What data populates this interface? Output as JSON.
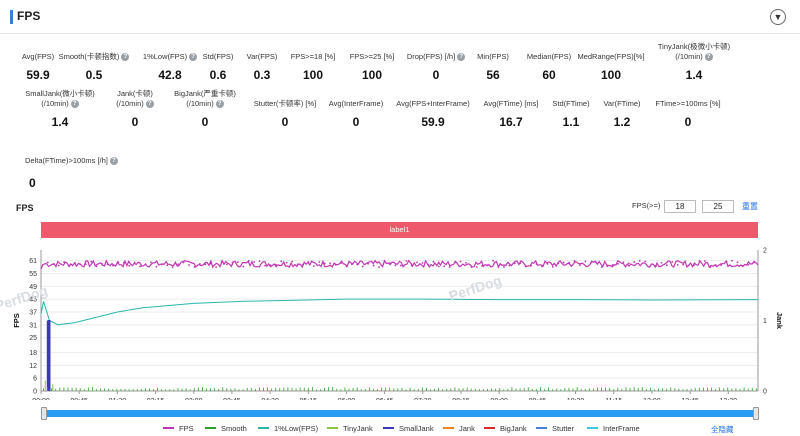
{
  "header": {
    "title": "FPS"
  },
  "metrics": [
    {
      "label": "Avg(FPS)",
      "value": "59.9",
      "q": false
    },
    {
      "label": "Smooth(卡顿指数)",
      "value": "0.5",
      "q": true
    },
    {
      "label": "1%Low(FPS)",
      "value": "42.8",
      "q": true
    },
    {
      "label": "Std(FPS)",
      "value": "0.6",
      "q": false
    },
    {
      "label": "Var(FPS)",
      "value": "0.3",
      "q": false
    },
    {
      "label": "FPS>=18 [%]",
      "value": "100",
      "q": false
    },
    {
      "label": "FPS>=25 [%]",
      "value": "100",
      "q": false
    },
    {
      "label": "Drop(FPS) [/h]",
      "value": "0",
      "q": true
    },
    {
      "label": "Min(FPS)",
      "value": "56",
      "q": false
    },
    {
      "label": "Median(FPS)",
      "value": "60",
      "q": false
    },
    {
      "label": "MedRange(FPS)[%]",
      "value": "100",
      "q": false
    },
    {
      "label": "TinyJank(极微小卡顿)",
      "label2": "(/10min)",
      "value": "1.4",
      "q": true
    },
    {
      "label": "SmallJank(微小卡顿)",
      "label2": "(/10min)",
      "value": "1.4",
      "q": true
    },
    {
      "label": "Jank(卡顿)",
      "label2": "(/10min)",
      "value": "0",
      "q": true
    },
    {
      "label": "BigJank(严重卡顿)",
      "label2": "(/10min)",
      "value": "0",
      "q": true
    },
    {
      "label": "Stutter(卡顿率) [%]",
      "value": "0",
      "q": false
    },
    {
      "label": "Avg(InterFrame)",
      "value": "0",
      "q": false
    },
    {
      "label": "Avg(FPS+InterFrame)",
      "value": "59.9",
      "q": false
    },
    {
      "label": "Avg(FTime) [ms]",
      "value": "16.7",
      "q": false
    },
    {
      "label": "Std(FTime)",
      "value": "1.1",
      "q": false
    },
    {
      "label": "Var(FTime)",
      "value": "1.2",
      "q": false
    },
    {
      "label": "FTime>=100ms [%]",
      "value": "0",
      "q": false
    },
    {
      "label": "Delta(FTime)>100ms [/h]",
      "value": "0",
      "q": true
    }
  ],
  "controls": {
    "chart_title": "FPS",
    "fps_threshold_label": "FPS(>=)",
    "threshold_1": "18",
    "threshold_2": "25",
    "reset_label": "重置",
    "label_band": "label1",
    "hide_all_label": "全隐藏"
  },
  "watermark": "PerfDog",
  "colors": {
    "fps": "#c233b5",
    "smooth": "#2aa12a",
    "low1": "#2ab7a9",
    "tinyjank": "#8cc63f",
    "smalljank": "#3a3ab8",
    "jank": "#f08020",
    "bigjank": "#e02a2a",
    "stutter": "#4a7fd8",
    "interframe": "#3cc8e0"
  },
  "chart_data": {
    "type": "line",
    "left_axis": {
      "label": "FPS",
      "ticks": [
        0,
        6,
        12,
        18,
        25,
        31,
        37,
        43,
        49,
        55,
        61
      ],
      "ylim": [
        0,
        66
      ]
    },
    "right_axis": {
      "label": "Jank",
      "ticks": [
        0,
        1,
        2
      ],
      "ylim": [
        0,
        2
      ]
    },
    "x_ticks": [
      "00:00",
      "00:45",
      "01:30",
      "02:15",
      "03:00",
      "03:45",
      "04:30",
      "05:15",
      "06:00",
      "06:45",
      "07:30",
      "08:15",
      "09:00",
      "09:45",
      "10:30",
      "11:15",
      "12:00",
      "12:45",
      "13:30"
    ],
    "x_tick_seconds": [
      0,
      45,
      90,
      135,
      180,
      225,
      270,
      315,
      360,
      405,
      450,
      495,
      540,
      585,
      630,
      675,
      720,
      765,
      810
    ],
    "xlim_seconds": [
      0,
      845
    ],
    "series": [
      {
        "name": "FPS",
        "axis": "left",
        "description_points": [
          [
            0,
            57
          ],
          [
            5,
            60
          ],
          [
            10,
            60
          ],
          [
            845,
            60
          ]
        ],
        "range": [
          58,
          61
        ]
      },
      {
        "name": "1%Low(FPS)",
        "axis": "left",
        "points": [
          [
            0,
            36
          ],
          [
            3,
            42
          ],
          [
            6,
            38
          ],
          [
            10,
            33
          ],
          [
            20,
            31
          ],
          [
            40,
            32
          ],
          [
            60,
            34
          ],
          [
            90,
            37
          ],
          [
            120,
            39
          ],
          [
            180,
            41
          ],
          [
            240,
            42
          ],
          [
            300,
            42.5
          ],
          [
            360,
            43
          ],
          [
            450,
            43
          ],
          [
            540,
            42.8
          ],
          [
            630,
            42.8
          ],
          [
            720,
            42.6
          ],
          [
            845,
            42.8
          ]
        ]
      },
      {
        "name": "SmallJank",
        "axis": "right",
        "bars": [
          [
            8,
            1
          ],
          [
            10,
            1
          ]
        ]
      },
      {
        "name": "TinyJank",
        "axis": "right",
        "note": "small spikes",
        "bars": [
          [
            5,
            0.15
          ],
          [
            14,
            0.1
          ]
        ]
      },
      {
        "name": "Smooth"
      },
      {
        "name": "Jank"
      },
      {
        "name": "BigJank"
      },
      {
        "name": "Stutter"
      },
      {
        "name": "InterFrame"
      }
    ]
  },
  "legend": [
    {
      "name": "FPS",
      "color": "#c233b5"
    },
    {
      "name": "Smooth",
      "color": "#2aa12a"
    },
    {
      "name": "1%Low(FPS)",
      "color": "#2ab7a9"
    },
    {
      "name": "TinyJank",
      "color": "#8cc63f"
    },
    {
      "name": "SmallJank",
      "color": "#3a3ab8"
    },
    {
      "name": "Jank",
      "color": "#f08020"
    },
    {
      "name": "BigJank",
      "color": "#e02a2a"
    },
    {
      "name": "Stutter",
      "color": "#4a7fd8"
    },
    {
      "name": "InterFrame",
      "color": "#3cc8e0"
    }
  ]
}
